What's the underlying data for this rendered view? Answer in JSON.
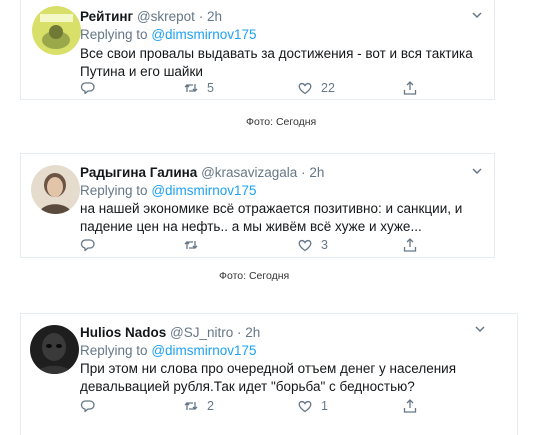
{
  "tweets": [
    {
      "name": "Рейтинг",
      "handle": "@skrepot",
      "dot": "·",
      "time": "2h",
      "reply_prefix": "Replying to",
      "reply_to": "@dimsmirnov175",
      "text": "Все свои провалы выдавать за достижения - вот и вся тактика Путина и его шайки",
      "retweets": "5",
      "likes": "22",
      "avatar_color": "#c8d84a"
    },
    {
      "name": "Радыгина Галина",
      "handle": "@krasavizagala",
      "dot": "·",
      "time": "2h",
      "reply_prefix": "Replying to",
      "reply_to": "@dimsmirnov175",
      "text": "на нашей экономике всё отражается позитивно: и санкции, и падение цен на нефть.. а мы живём всё хуже и хуже...",
      "retweets": "",
      "likes": "3",
      "avatar_color": "#c9b49a"
    },
    {
      "name": "Hulios Nados",
      "handle": "@SJ_nitro",
      "dot": "·",
      "time": "2h",
      "reply_prefix": "Replying to",
      "reply_to": "@dimsmirnov175",
      "text": "При этом ни слова про очередной отъем денег у населения девальвацией рубля.Так идет \"борьба\" с бедностью?",
      "retweets": "2",
      "likes": "1",
      "avatar_color": "#2a2a2a"
    }
  ],
  "captions": [
    "Фото: Сегодня",
    "Фото: Сегодня"
  ],
  "icons": [
    "reply-icon",
    "retweet-icon",
    "like-icon",
    "share-icon",
    "caret-down-icon"
  ],
  "colors": {
    "link": "#1da1f2",
    "muted": "#657786",
    "border": "#e6ecf0"
  }
}
